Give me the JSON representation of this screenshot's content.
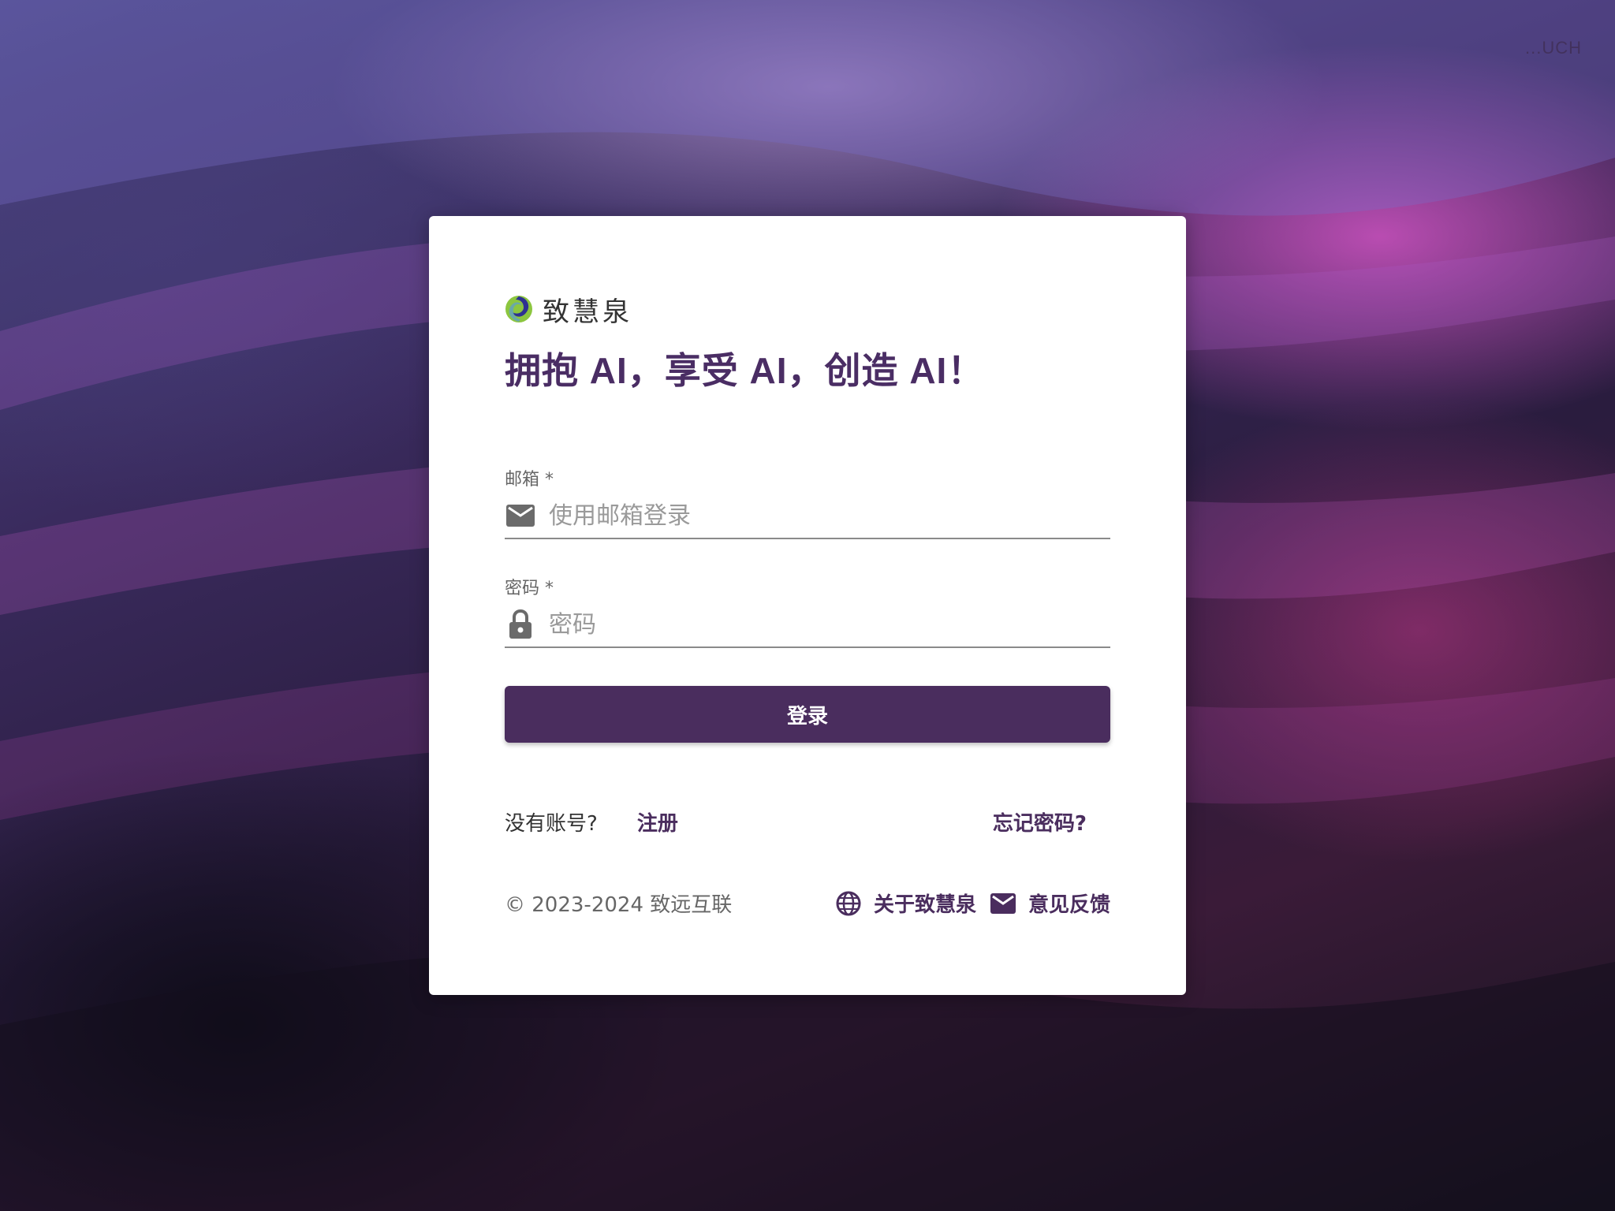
{
  "corner": {
    "text": "...UCH"
  },
  "brand": {
    "name": "致慧泉",
    "logo_icon": "swirl-logo-icon"
  },
  "headline": "拥抱 AI，享受 AI，创造 AI！",
  "form": {
    "email": {
      "label": "邮箱 *",
      "placeholder": "使用邮箱登录",
      "value": "",
      "icon": "mail-icon"
    },
    "password": {
      "label": "密码 *",
      "placeholder": "密码",
      "value": "",
      "icon": "lock-icon"
    },
    "submit_label": "登录"
  },
  "links": {
    "no_account": "没有账号?",
    "register": "注册",
    "forgot": "忘记密码?"
  },
  "footer": {
    "copyright": "© 2023-2024 致远互联",
    "about": {
      "label": "关于致慧泉",
      "icon": "globe-icon"
    },
    "feedback": {
      "label": "意见反馈",
      "icon": "mail-icon"
    }
  },
  "colors": {
    "primary": "#4a2d5e",
    "headline": "#4a2d64",
    "card_bg": "#ffffff"
  }
}
